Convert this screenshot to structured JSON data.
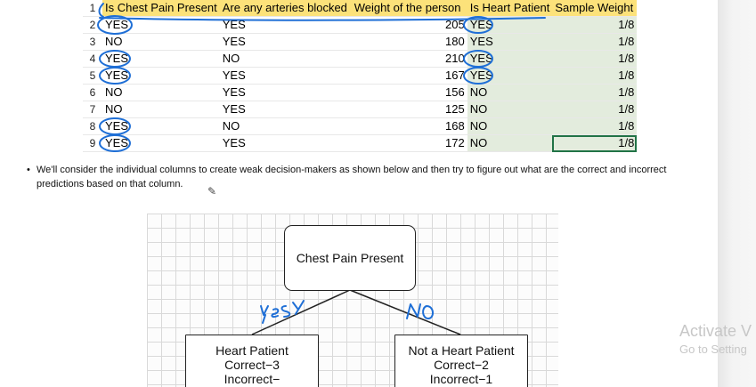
{
  "sheet": {
    "headers": [
      "Is Chest Pain Present",
      "Are any arteries blocked",
      "Weight of the person",
      "Is Heart Patient",
      "Sample Weight"
    ],
    "rows": [
      {
        "n": "1",
        "cells": [
          "",
          "",
          "",
          "",
          ""
        ]
      },
      {
        "n": "2",
        "cells": [
          "YES",
          "YES",
          "205",
          "YES",
          "1/8"
        ]
      },
      {
        "n": "3",
        "cells": [
          "NO",
          "YES",
          "180",
          "YES",
          "1/8"
        ]
      },
      {
        "n": "4",
        "cells": [
          "YES",
          "NO",
          "210",
          "YES",
          "1/8"
        ]
      },
      {
        "n": "5",
        "cells": [
          "YES",
          "YES",
          "167",
          "YES",
          "1/8"
        ]
      },
      {
        "n": "6",
        "cells": [
          "NO",
          "YES",
          "156",
          "NO",
          "1/8"
        ]
      },
      {
        "n": "7",
        "cells": [
          "NO",
          "YES",
          "125",
          "NO",
          "1/8"
        ]
      },
      {
        "n": "8",
        "cells": [
          "YES",
          "NO",
          "168",
          "NO",
          "1/8"
        ]
      },
      {
        "n": "9",
        "cells": [
          "YES",
          "YES",
          "172",
          "NO",
          "1/8"
        ]
      }
    ],
    "header_color": "#fce27a",
    "green_color": "#e3ecdd"
  },
  "bullet": {
    "glyph": "•",
    "text": "We'll consider the individual columns to create weak decision-makers as shown below and then try to figure out what are the correct and incorrect predictions based on that column."
  },
  "diagram": {
    "root": "Chest Pain Present",
    "left": {
      "title": "Heart Patient",
      "correct": "Correct−3",
      "incorrect": "Incorrect−"
    },
    "right": {
      "title": "Not a Heart Patient",
      "correct": "Correct−2",
      "incorrect": "Incorrect−1"
    }
  },
  "watermark": {
    "line1": "Activate V",
    "line2": "Go to Setting"
  },
  "ink_color": "#1f6fd6",
  "icons": [
    "pencil-cursor-icon"
  ]
}
